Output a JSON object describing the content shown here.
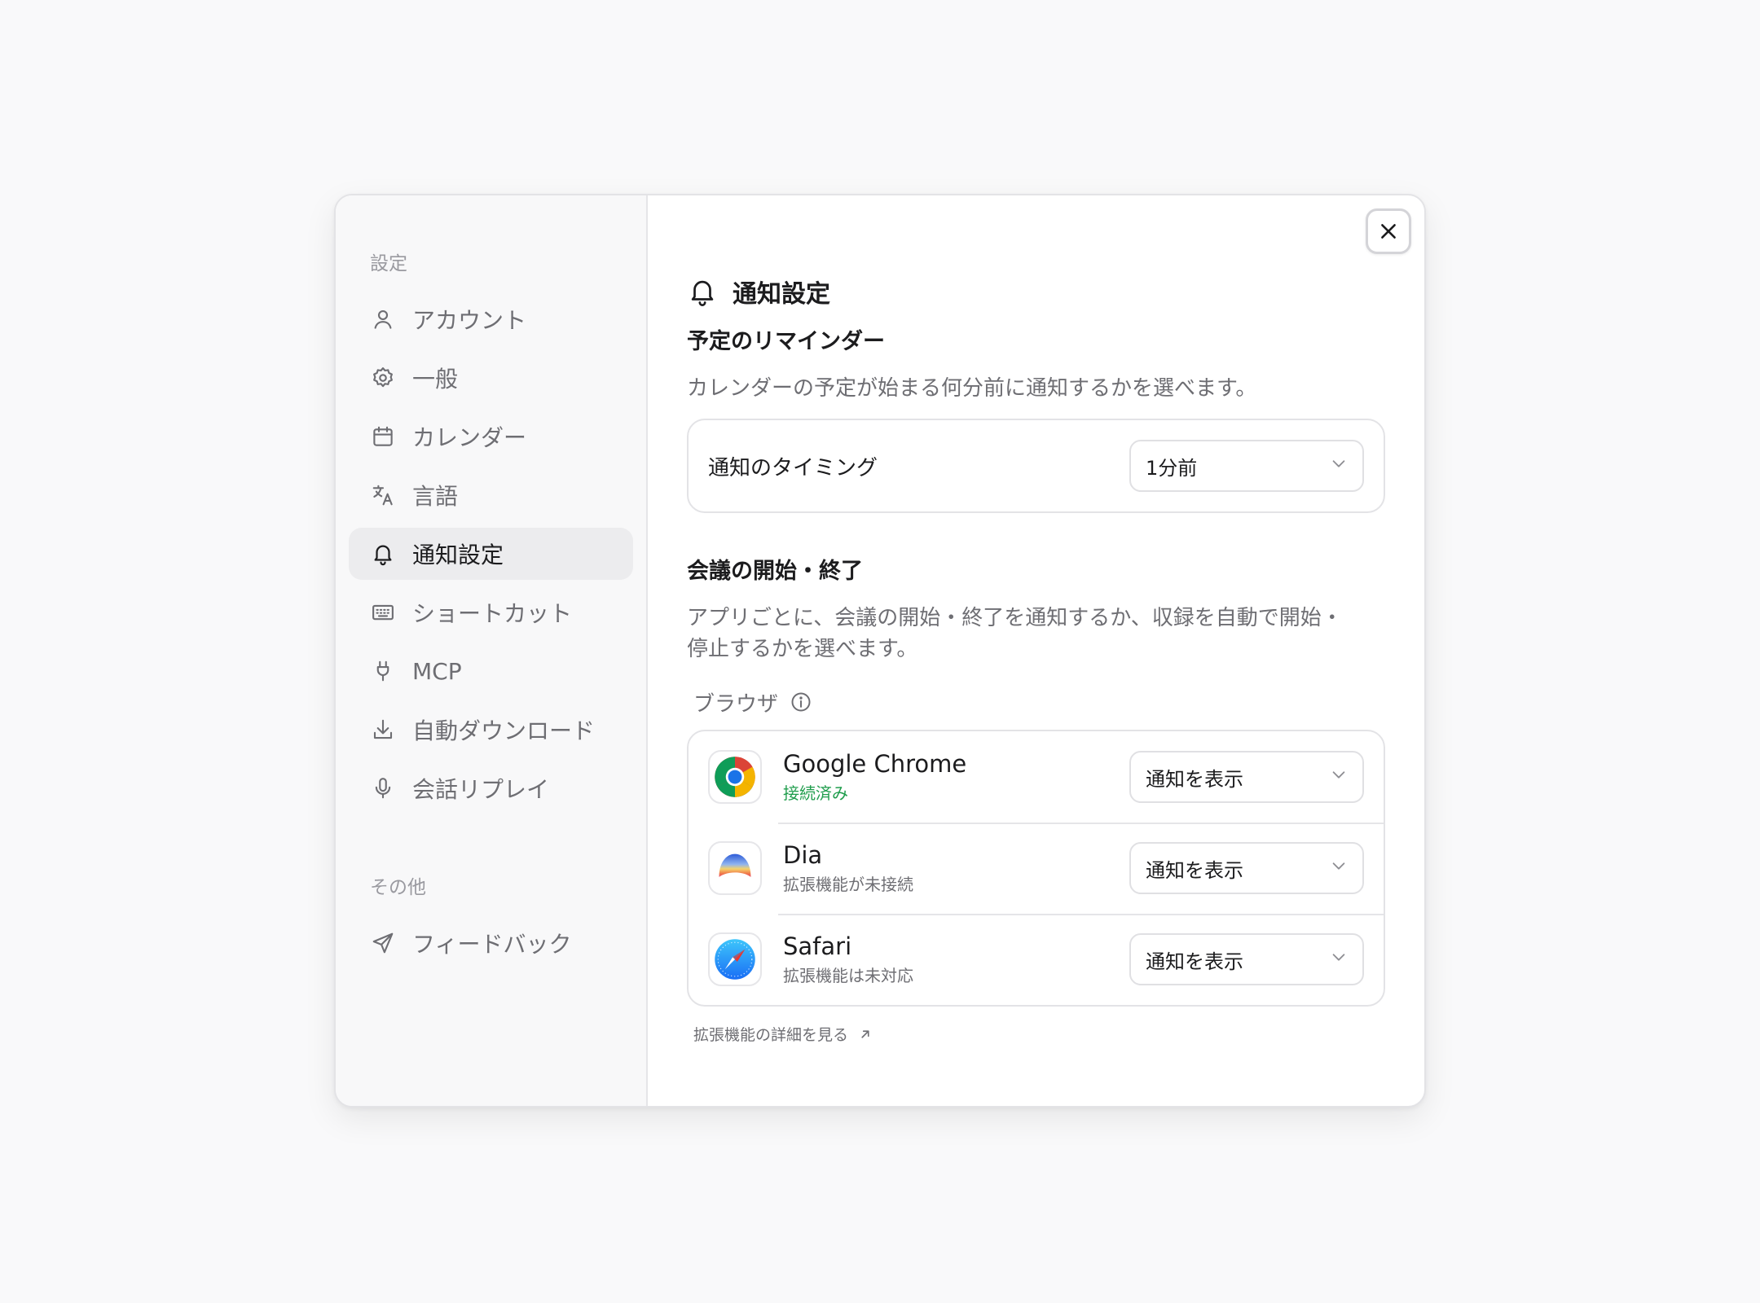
{
  "sidebar": {
    "heading": "設定",
    "items": [
      {
        "label": "アカウント",
        "icon": "user-icon"
      },
      {
        "label": "一般",
        "icon": "gear-icon"
      },
      {
        "label": "カレンダー",
        "icon": "calendar-icon"
      },
      {
        "label": "言語",
        "icon": "translate-icon"
      },
      {
        "label": "通知設定",
        "icon": "bell-icon",
        "active": true
      },
      {
        "label": "ショートカット",
        "icon": "keyboard-icon"
      },
      {
        "label": "MCP",
        "icon": "plug-icon"
      },
      {
        "label": "自動ダウンロード",
        "icon": "download-icon"
      },
      {
        "label": "会話リプレイ",
        "icon": "microphone-icon"
      }
    ],
    "other_heading": "その他",
    "other_items": [
      {
        "label": "フィードバック",
        "icon": "send-icon"
      }
    ]
  },
  "main": {
    "title": "通知設定",
    "reminder": {
      "title": "予定のリマインダー",
      "description": "カレンダーの予定が始まる何分前に通知するかを選べます。",
      "timing_label": "通知のタイミング",
      "timing_value": "1分前"
    },
    "meeting": {
      "title": "会議の開始・終了",
      "description_line1": "アプリごとに、会議の開始・終了を通知するか、収録を自動で開始・",
      "description_line2": "停止するかを選べます。",
      "browser_label": "ブラウザ",
      "browsers": [
        {
          "name": "Google Chrome",
          "status": "接続済み",
          "status_ok": true,
          "value": "通知を表示"
        },
        {
          "name": "Dia",
          "status": "拡張機能が未接続",
          "status_ok": false,
          "value": "通知を表示"
        },
        {
          "name": "Safari",
          "status": "拡張機能は未対応",
          "status_ok": false,
          "value": "通知を表示"
        }
      ],
      "extension_link": "拡張機能の詳細を見る"
    }
  },
  "colors": {
    "connected": "#1f9d4c",
    "active_bg": "#ececee",
    "muted_text": "#6e6e73"
  }
}
